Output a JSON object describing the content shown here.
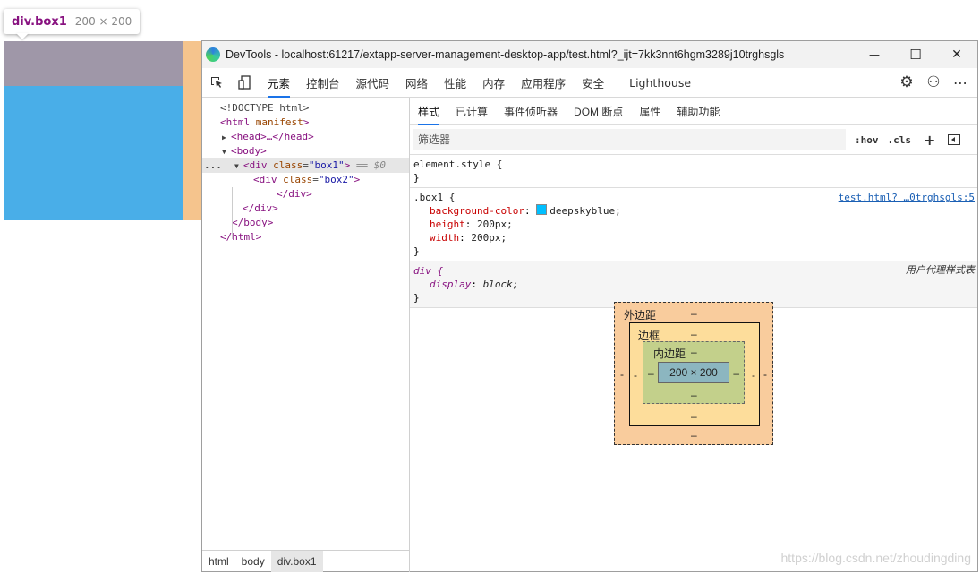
{
  "tooltip": {
    "selector": "div.box1",
    "dims": "200 × 200"
  },
  "window": {
    "title": "DevTools - localhost:61217/extapp-server-management-desktop-app/test.html?_ijt=7kk3nnt6hgm3289j10trghsgls",
    "min_glyph": "—",
    "max_glyph": "☐",
    "close_glyph": "✕"
  },
  "tabs": [
    {
      "label": "元素"
    },
    {
      "label": "控制台"
    },
    {
      "label": "源代码"
    },
    {
      "label": "网络"
    },
    {
      "label": "性能"
    },
    {
      "label": "内存"
    },
    {
      "label": "应用程序"
    },
    {
      "label": "安全"
    },
    {
      "label": "Lighthouse"
    }
  ],
  "toolbar": {
    "settings_glyph": "⚙",
    "feedback_glyph": "⚇",
    "more_glyph": "⋯"
  },
  "dom": {
    "doctype": "<!DOCTYPE html>",
    "html_open": "<html",
    "html_attr": "manifest",
    "html_close_bracket": ">",
    "head": "<head>…</head>",
    "body_open": "<body>",
    "dots": "...",
    "div1_open": "<div",
    "div1_attr": "class",
    "div1_val": "\"box1\"",
    "div1_end": ">",
    "div1_marker": "== $0",
    "div2_open": "<div",
    "div2_attr": "class",
    "div2_val": "\"box2\"",
    "div2_end": ">",
    "div2_close": "</div>",
    "div1_close": "</div>",
    "body_close": "</body>",
    "html_close": "</html>",
    "eq": "="
  },
  "breadcrumb": [
    "html",
    "body",
    "div.box1"
  ],
  "subtabs": [
    "样式",
    "已计算",
    "事件侦听器",
    "DOM 断点",
    "属性",
    "辅助功能"
  ],
  "filter": {
    "placeholder": "筛选器",
    "hov": ":hov",
    "cls": ".cls",
    "plus": "+"
  },
  "rules": {
    "element_style": {
      "selector": "element.style {",
      "close": "}"
    },
    "box1": {
      "selector": ".box1 {",
      "source": "test.html? …0trghsgls:5",
      "props": [
        {
          "name": "background-color",
          "value": "deepskyblue;"
        },
        {
          "name": "height",
          "value": "200px;"
        },
        {
          "name": "width",
          "value": "200px;"
        }
      ],
      "close": "}",
      "swatch_color": "#00bfff"
    },
    "div_ua": {
      "selector": "div {",
      "source": "用户代理样式表",
      "props": [
        {
          "name": "display",
          "value": "block;"
        }
      ],
      "close": "}"
    }
  },
  "box_model": {
    "margin_label": "外边距",
    "border_label": "边框",
    "padding_label": "内边距",
    "content": "200 × 200",
    "dash": "–",
    "dash2": "-"
  },
  "watermark": "https://blog.csdn.net/zhoudingding"
}
